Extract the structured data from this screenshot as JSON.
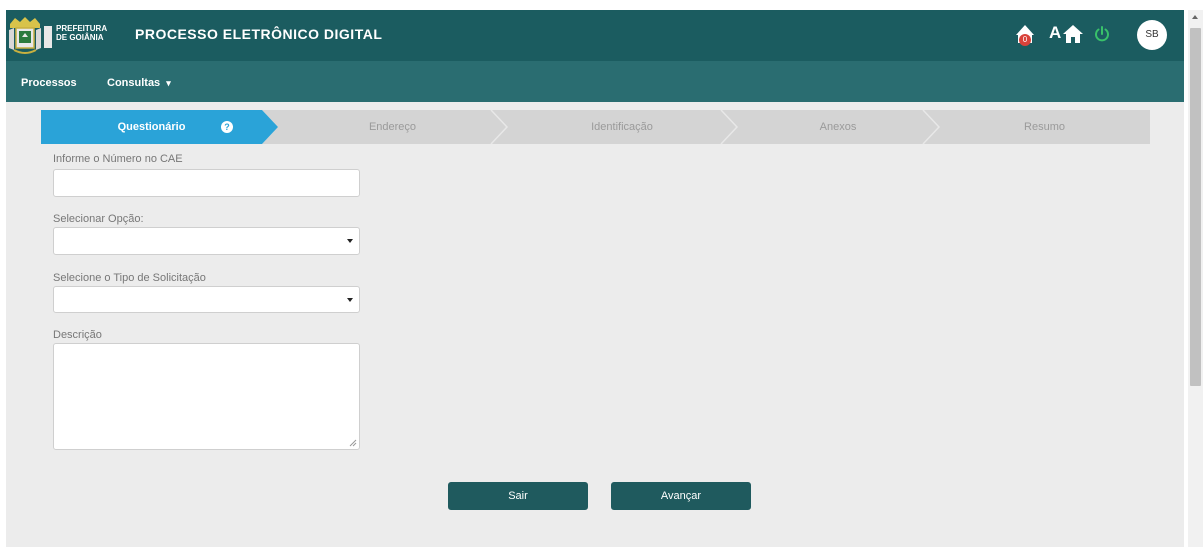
{
  "header": {
    "org_line1": "PREFEITURA",
    "org_line2": "DE GOIÂNIA",
    "title": "PROCESSO ELETRÔNICO DIGITAL",
    "notification_count": "0",
    "font_icon_text": "A",
    "avatar_initials": "SB"
  },
  "nav": {
    "processos": "Processos",
    "consultas": "Consultas"
  },
  "steps": [
    {
      "label": "Questionário",
      "active": true
    },
    {
      "label": "Endereço",
      "active": false
    },
    {
      "label": "Identificação",
      "active": false
    },
    {
      "label": "Anexos",
      "active": false
    },
    {
      "label": "Resumo",
      "active": false
    }
  ],
  "form": {
    "cae_label": "Informe o Número no CAE",
    "cae_value": "",
    "opcao_label": "Selecionar Opção:",
    "opcao_value": "",
    "tipo_label": "Selecione o Tipo de Solicitação",
    "tipo_value": "",
    "descricao_label": "Descrição",
    "descricao_value": ""
  },
  "buttons": {
    "sair": "Sair",
    "avancar": "Avançar"
  },
  "colors": {
    "header_bg": "#1b5c60",
    "nav_bg": "#2a6d71",
    "step_active": "#2aa3d8",
    "step_inactive": "#d4d4d4",
    "button_bg": "#1f5a5e"
  }
}
